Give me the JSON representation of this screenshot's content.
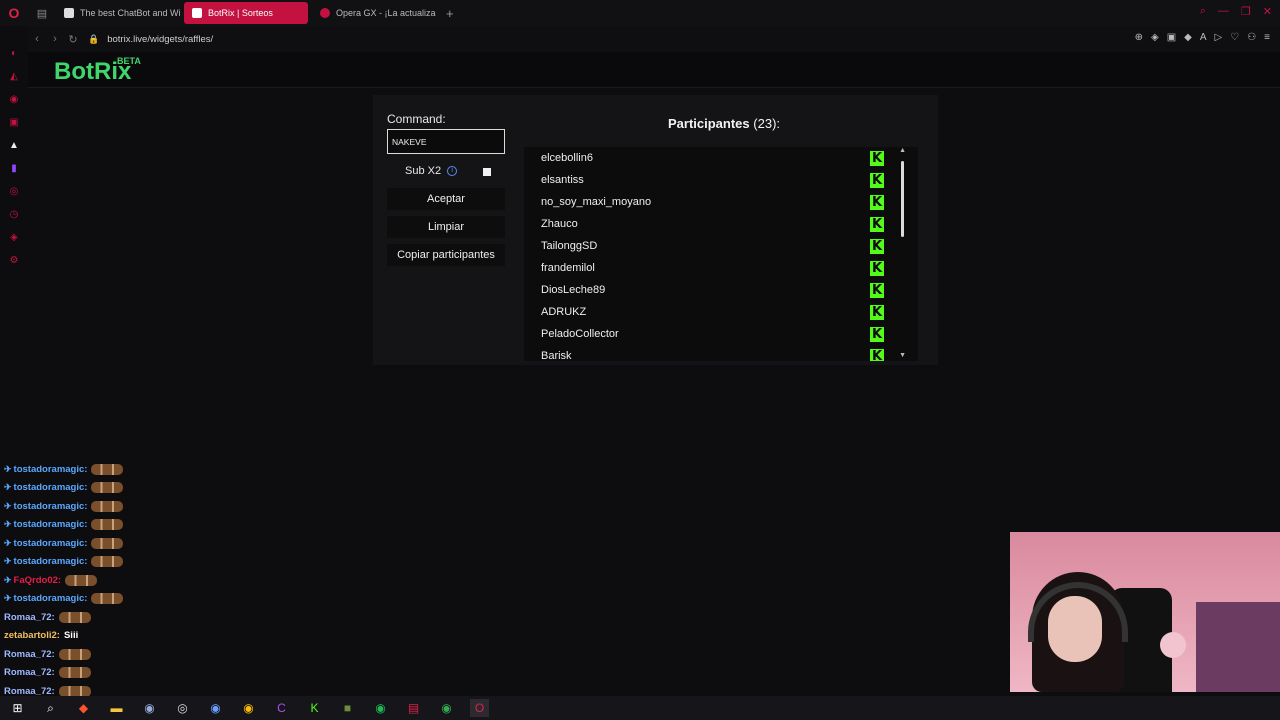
{
  "browser": {
    "tabs": [
      {
        "label": "The best ChatBot and Wi",
        "favicon_color": "#e6e6e6"
      },
      {
        "label": "BotRix | Sorteos",
        "favicon_color": "#ffffff",
        "active": true
      },
      {
        "label": "Opera GX - ¡La actualizac",
        "favicon_color": "#c3123f"
      }
    ],
    "url": "botrix.live/widgets/raffles/",
    "accent": "#c3123f"
  },
  "site": {
    "brand": "BotRix",
    "beta": "BETA",
    "brand_color": "#3fd66d"
  },
  "widget": {
    "command_label": "Command:",
    "command_value": "NAKEVE",
    "sub_label": "Sub X2",
    "sub_checked": false,
    "buttons": {
      "accept": "Aceptar",
      "clear": "Limpiar",
      "copy": "Copiar participantes"
    },
    "participants_title": "Participantes",
    "participants_count": "(23):",
    "platform_icon": "kick-logo-icon",
    "platform_color": "#53fc18",
    "participants": [
      "elcebollin6",
      "elsantiss",
      "no_soy_maxi_moyano",
      "Zhauco",
      "TailonggSD",
      "frandemilol",
      "DiosLeche89",
      "ADRUKZ",
      "PeladoCollector",
      "Barisk"
    ]
  },
  "chat": [
    {
      "user": "tostadoramagic:",
      "color": "#5aa8ff",
      "badge": true,
      "message": ""
    },
    {
      "user": "tostadoramagic:",
      "color": "#5aa8ff",
      "badge": true,
      "message": ""
    },
    {
      "user": "tostadoramagic:",
      "color": "#5aa8ff",
      "badge": true,
      "message": ""
    },
    {
      "user": "tostadoramagic:",
      "color": "#5aa8ff",
      "badge": true,
      "message": ""
    },
    {
      "user": "tostadoramagic:",
      "color": "#5aa8ff",
      "badge": true,
      "message": ""
    },
    {
      "user": "tostadoramagic:",
      "color": "#5aa8ff",
      "badge": true,
      "message": ""
    },
    {
      "user": "FaQrdo02:",
      "color": "#e0204a",
      "badge": true,
      "message": ""
    },
    {
      "user": "tostadoramagic:",
      "color": "#5aa8ff",
      "badge": true,
      "message": ""
    },
    {
      "user": "Romaa_72:",
      "color": "#9fb8ff",
      "badge": false,
      "message": ""
    },
    {
      "user": "zetabartoli2:",
      "color": "#f0c060",
      "badge": false,
      "message": "Siii"
    },
    {
      "user": "Romaa_72:",
      "color": "#9fb8ff",
      "badge": false,
      "message": ""
    },
    {
      "user": "Romaa_72:",
      "color": "#9fb8ff",
      "badge": false,
      "message": ""
    },
    {
      "user": "Romaa_72:",
      "color": "#9fb8ff",
      "badge": false,
      "message": ""
    }
  ]
}
